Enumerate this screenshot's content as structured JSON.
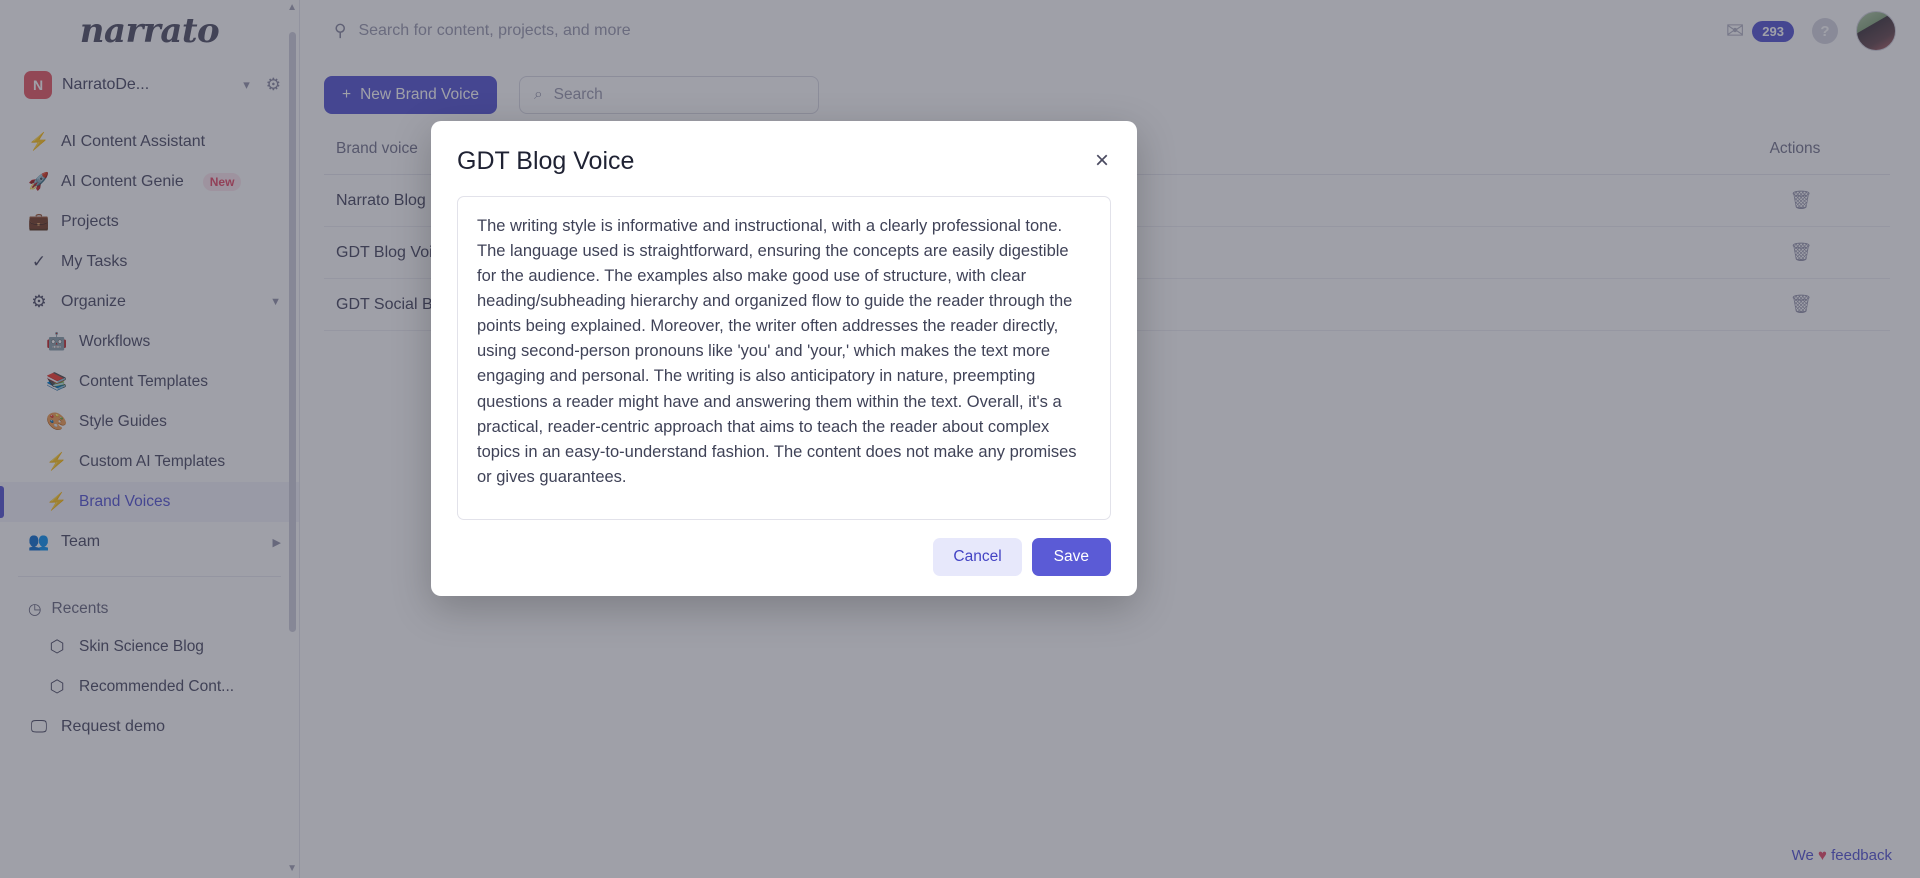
{
  "sidebar": {
    "logo": "narrato",
    "workspace": {
      "initial": "N",
      "name": "NarratoDe...",
      "chevron": "⌵",
      "gear": "⚙"
    },
    "items": [
      {
        "icon": "⚡",
        "label": "AI Content Assistant",
        "badge": ""
      },
      {
        "icon": "🚀",
        "label": "AI Content Genie",
        "badge": "New"
      },
      {
        "icon": "💼",
        "label": "Projects",
        "badge": ""
      },
      {
        "icon": "✓",
        "label": "My Tasks",
        "badge": ""
      },
      {
        "icon": "⚙",
        "label": "Organize",
        "badge": ""
      }
    ],
    "sub_items": [
      {
        "icon": "🤖",
        "label": "Workflows"
      },
      {
        "icon": "📚",
        "label": "Content Templates"
      },
      {
        "icon": "🎨",
        "label": "Style Guides"
      },
      {
        "icon": "⚡",
        "label": "Custom AI Templates"
      },
      {
        "icon": "⚡",
        "label": "Brand Voices"
      }
    ],
    "team": {
      "icon": "👥",
      "label": "Team",
      "caret": "▸"
    },
    "recents_title": {
      "icon": "◷",
      "label": "Recents"
    },
    "recents": [
      {
        "icon": "⬡",
        "label": "Skin Science Blog"
      },
      {
        "icon": "⬡",
        "label": "Recommended Cont..."
      }
    ],
    "request_demo": {
      "icon": "🖵",
      "label": "Request demo"
    }
  },
  "topbar": {
    "search_placeholder": "Search for content, projects, and more",
    "mail_icon": "✉",
    "mail_count": "293",
    "help_label": "?"
  },
  "toolbar": {
    "new_button": "New Brand Voice",
    "new_button_icon": "+",
    "search_placeholder": "Search",
    "search_icon": "⌕"
  },
  "table": {
    "columns": [
      "Brand voice",
      "Actions"
    ],
    "rows": [
      {
        "name": "Narrato Blog Brand Voice",
        "action_icon": "🗑"
      },
      {
        "name": "GDT Blog Voice",
        "action_icon": "🗑"
      },
      {
        "name": "GDT Social Brand Voice",
        "action_icon": "🗑"
      }
    ]
  },
  "feedback": {
    "prefix": "We",
    "heart": "♥",
    "link": "feedback"
  },
  "modal": {
    "title": "GDT Blog Voice",
    "close_icon": "×",
    "description": "The writing style is informative and instructional, with a clearly professional tone. The language used is straightforward, ensuring the concepts are easily digestible for the audience. The examples also make good use of structure, with clear heading/subheading hierarchy and organized flow to guide the reader through the points being explained. Moreover, the writer often addresses the reader directly, using second-person pronouns like 'you' and 'your,' which makes the text more engaging and personal. The writing is also anticipatory in nature, preempting questions a reader might have and answering them within the text. Overall, it's a practical, reader-centric approach that aims to teach the reader about complex topics in an easy-to-understand fashion. The content does not make any promises or gives guarantees.",
    "cancel_label": "Cancel",
    "save_label": "Save"
  },
  "colors": {
    "accent": "#5b5bd6",
    "accent_soft": "#e7e8fb",
    "badge_new_bg": "#fde8ee",
    "badge_new_text": "#e8506e",
    "heart": "#e8506e",
    "workspace_avatar": "#e8606b"
  }
}
